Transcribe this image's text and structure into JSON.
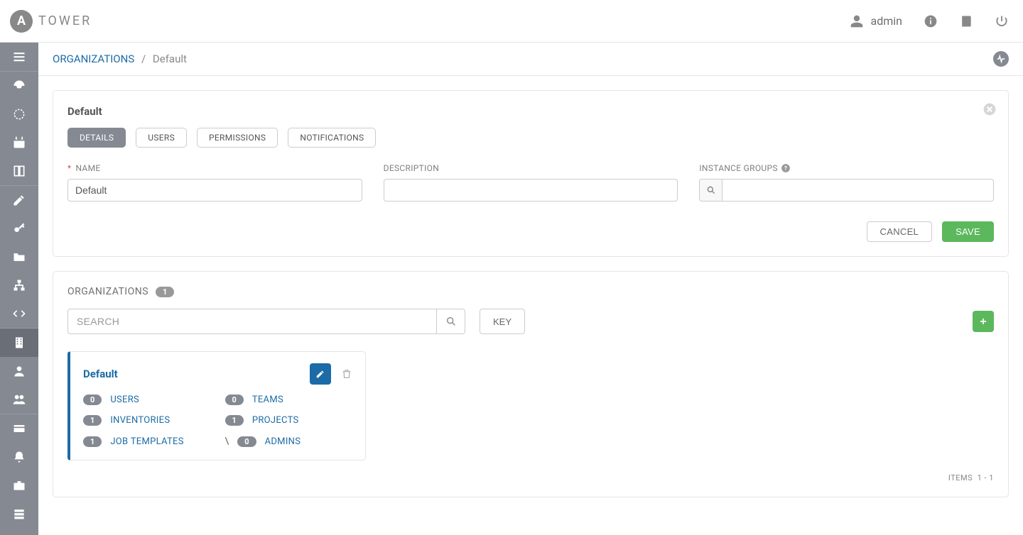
{
  "brand": {
    "name": "TOWER",
    "mark": "A"
  },
  "topbar": {
    "user": "admin"
  },
  "breadcrumb": {
    "root": "ORGANIZATIONS",
    "current": "Default"
  },
  "detailPanel": {
    "title": "Default",
    "tabs": {
      "details": "DETAILS",
      "users": "USERS",
      "permissions": "PERMISSIONS",
      "notifications": "NOTIFICATIONS"
    },
    "fields": {
      "name": {
        "label": "NAME",
        "value": "Default"
      },
      "desc": {
        "label": "DESCRIPTION",
        "value": ""
      },
      "igrp": {
        "label": "INSTANCE GROUPS",
        "value": ""
      }
    },
    "actions": {
      "cancel": "CANCEL",
      "save": "SAVE"
    }
  },
  "list": {
    "title": "ORGANIZATIONS",
    "count": "1",
    "search_placeholder": "SEARCH",
    "key_label": "KEY",
    "items_label": "ITEMS",
    "items_range": "1 - 1",
    "card": {
      "name": "Default",
      "stats": {
        "users": {
          "label": "USERS",
          "count": "0"
        },
        "teams": {
          "label": "TEAMS",
          "count": "0"
        },
        "inventories": {
          "label": "INVENTORIES",
          "count": "1"
        },
        "projects": {
          "label": "PROJECTS",
          "count": "1"
        },
        "job_templates": {
          "label": "JOB TEMPLATES",
          "count": "1"
        },
        "admins": {
          "label": "ADMINS",
          "count": "0"
        }
      }
    }
  }
}
